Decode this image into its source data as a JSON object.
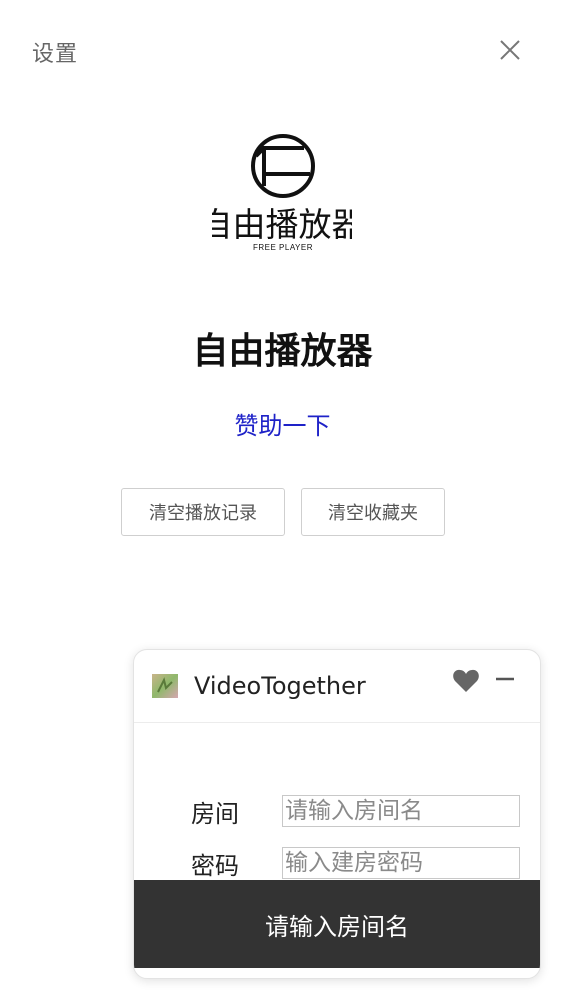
{
  "header": {
    "title": "设置"
  },
  "icons": {
    "close": "close-icon",
    "logo": "free-player-logo",
    "vt_app": "videotogether-icon",
    "heart": "heart-icon",
    "minimize": "minimize-icon"
  },
  "logo": {
    "text_cn": "自由播放器",
    "text_en": "FREE PLAYER"
  },
  "app": {
    "name": "自由播放器",
    "sponsor_label": "赞助一下"
  },
  "actions": {
    "clear_history_label": "清空播放记录",
    "clear_favorites_label": "清空收藏夹"
  },
  "vt_panel": {
    "title": "VideoTogether",
    "room_label": "房间",
    "room_placeholder": "请输入房间名",
    "password_label": "密码",
    "password_placeholder": "输入建房密码",
    "footer_label": "请输入房间名"
  },
  "colors": {
    "link": "#1e22c8",
    "footer_bg": "#333333",
    "text_muted": "#666666"
  }
}
